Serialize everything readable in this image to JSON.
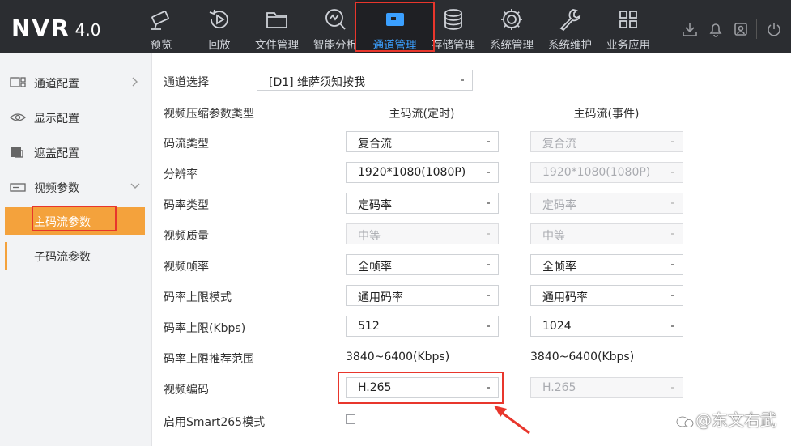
{
  "app": {
    "logo_main": "NVR",
    "logo_version": "4.0"
  },
  "nav": [
    {
      "label": "预览",
      "icon": "camera-icon"
    },
    {
      "label": "回放",
      "icon": "replay-icon"
    },
    {
      "label": "文件管理",
      "icon": "folder-icon"
    },
    {
      "label": "智能分析",
      "icon": "analysis-icon"
    },
    {
      "label": "通道管理",
      "icon": "channel-camera-icon",
      "active": true
    },
    {
      "label": "存储管理",
      "icon": "database-icon"
    },
    {
      "label": "系统管理",
      "icon": "gear-icon"
    },
    {
      "label": "系统维护",
      "icon": "wrench-icon"
    },
    {
      "label": "业务应用",
      "icon": "apps-grid-icon"
    }
  ],
  "tools": [
    "download-icon",
    "bell-icon",
    "user-card-icon",
    "power-icon"
  ],
  "sidebar": {
    "items": [
      {
        "label": "通道配置",
        "icon": "channel-config-icon",
        "chevron": "right"
      },
      {
        "label": "显示配置",
        "icon": "eye-icon",
        "chevron": ""
      },
      {
        "label": "遮盖配置",
        "icon": "mask-icon",
        "chevron": ""
      },
      {
        "label": "视频参数",
        "icon": "video-param-icon",
        "chevron": "down"
      }
    ],
    "sub_items": [
      {
        "label": "主码流参数",
        "active": true
      },
      {
        "label": "子码流参数",
        "active": false
      }
    ]
  },
  "form": {
    "channel_select_label": "通道选择",
    "channel_select_value": "[D1] 维萨须知按我",
    "compress_type_label": "视频压缩参数类型",
    "col_timed": "主码流(定时)",
    "col_event": "主码流(事件)",
    "rows": [
      {
        "label": "码流类型",
        "timed": "复合流",
        "timed_disabled": false,
        "event": "复合流",
        "event_disabled": true
      },
      {
        "label": "分辨率",
        "timed": "1920*1080(1080P)",
        "timed_disabled": false,
        "event": "1920*1080(1080P)",
        "event_disabled": true
      },
      {
        "label": "码率类型",
        "timed": "定码率",
        "timed_disabled": false,
        "event": "定码率",
        "event_disabled": true
      },
      {
        "label": "视频质量",
        "timed": "中等",
        "timed_disabled": true,
        "event": "中等",
        "event_disabled": true
      },
      {
        "label": "视频帧率",
        "timed": "全帧率",
        "timed_disabled": false,
        "event": "全帧率",
        "event_disabled": false
      },
      {
        "label": "码率上限模式",
        "timed": "通用码率",
        "timed_disabled": false,
        "event": "通用码率",
        "event_disabled": false
      },
      {
        "label": "码率上限(Kbps)",
        "timed": "512",
        "timed_disabled": false,
        "event": "1024",
        "event_disabled": false
      }
    ],
    "range_label": "码率上限推荐范围",
    "range_timed": "3840~6400(Kbps)",
    "range_event": "3840~6400(Kbps)",
    "codec_label": "视频编码",
    "codec_timed": "H.265",
    "codec_event": "H.265",
    "smart_label": "启用Smart265模式"
  },
  "watermark": "@东文右武",
  "colors": {
    "accent_orange": "#f4a23c",
    "highlight_red": "#e8362c",
    "topbar": "#2b2d31",
    "active_blue": "#3ba0ff"
  }
}
